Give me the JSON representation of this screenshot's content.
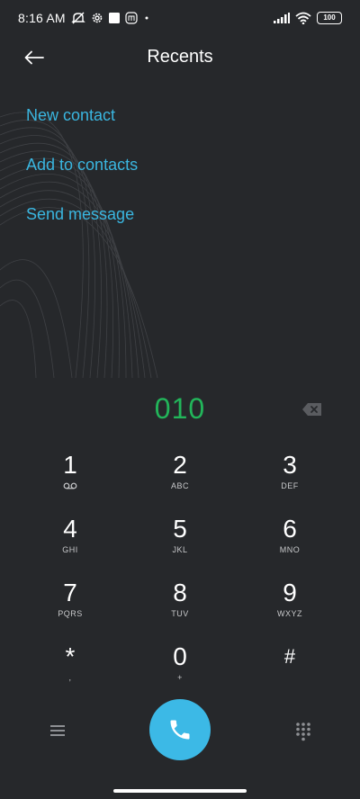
{
  "status_bar": {
    "time": "8:16 AM",
    "battery": "100",
    "icons_left": [
      "mute-icon",
      "gear-icon",
      "square-icon",
      "mi-icon",
      "dot-icon"
    ],
    "icons_right": [
      "signal-icon",
      "wifi-icon",
      "battery-icon"
    ]
  },
  "header": {
    "title": "Recents",
    "back_icon": "arrow-left-icon"
  },
  "actions": [
    {
      "label": "New contact"
    },
    {
      "label": "Add to contacts"
    },
    {
      "label": "Send message"
    }
  ],
  "dialer": {
    "number": "010",
    "backspace_icon": "backspace-icon"
  },
  "keypad": [
    {
      "digit": "1",
      "letters": "",
      "sub_icon": "voicemail-icon"
    },
    {
      "digit": "2",
      "letters": "ABC"
    },
    {
      "digit": "3",
      "letters": "DEF"
    },
    {
      "digit": "4",
      "letters": "GHI"
    },
    {
      "digit": "5",
      "letters": "JKL"
    },
    {
      "digit": "6",
      "letters": "MNO"
    },
    {
      "digit": "7",
      "letters": "PQRS"
    },
    {
      "digit": "8",
      "letters": "TUV"
    },
    {
      "digit": "9",
      "letters": "WXYZ"
    },
    {
      "digit": "*",
      "letters": ","
    },
    {
      "digit": "0",
      "letters": "+"
    },
    {
      "digit": "#",
      "letters": ""
    }
  ],
  "bottom_bar": {
    "menu_icon": "menu-icon",
    "call_icon": "phone-icon",
    "dialpad_icon": "dialpad-icon"
  },
  "colors": {
    "background": "#26282b",
    "accent": "#3ab6e0",
    "number": "#22b55a",
    "call_button": "#3cb9e6"
  }
}
